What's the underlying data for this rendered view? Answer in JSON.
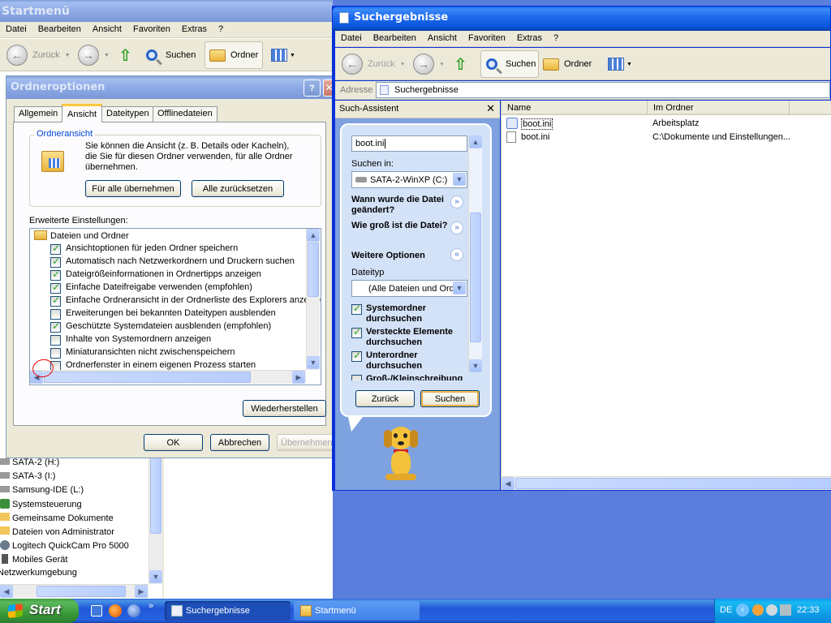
{
  "background_window": {
    "title": "Startmenü",
    "menu": [
      "Datei",
      "Bearbeiten",
      "Ansicht",
      "Favoriten",
      "Extras",
      "?"
    ],
    "toolbar": {
      "back": "Zurück",
      "search": "Suchen",
      "folders": "Ordner"
    },
    "tree_items": [
      "SATA-2 (H:)",
      "SATA-3 (I:)",
      "Samsung-IDE (L:)",
      "Systemsteuerung",
      "Gemeinsame Dokumente",
      "Dateien von Administrator",
      "Logitech QuickCam Pro 5000",
      "Mobiles Gerät",
      "Netzwerkumgebung"
    ]
  },
  "dialog": {
    "title": "Ordneroptionen",
    "tabs": [
      "Allgemein",
      "Ansicht",
      "Dateitypen",
      "Offlinedateien"
    ],
    "group_title": "Ordneransicht",
    "description": "Sie können die Ansicht (z. B. Details oder Kacheln), die Sie für diesen Ordner verwenden, für alle Ordner übernehmen.",
    "apply_all": "Für alle übernehmen",
    "reset_all": "Alle zurücksetzen",
    "advanced_label": "Erweiterte Einstellungen:",
    "folder_node": "Dateien und Ordner",
    "settings": [
      {
        "label": "Ansichtoptionen für jeden Ordner speichern",
        "checked": true
      },
      {
        "label": "Automatisch nach Netzwerkordnern und Druckern suchen",
        "checked": true
      },
      {
        "label": "Dateigrößeinformationen in Ordnertipps anzeigen",
        "checked": true
      },
      {
        "label": "Einfache Dateifreigabe verwenden (empfohlen)",
        "checked": true
      },
      {
        "label": "Einfache Ordneransicht in der Ordnerliste des Explorers anzeige",
        "checked": true
      },
      {
        "label": "Erweiterungen bei bekannten Dateitypen ausblenden",
        "checked": false
      },
      {
        "label": "Geschützte Systemdateien ausblenden (empfohlen)",
        "checked": true
      },
      {
        "label": "Inhalte von Systemordnern anzeigen",
        "checked": false
      },
      {
        "label": "Miniaturansichten nicht zwischenspeichern",
        "checked": false
      },
      {
        "label": "Ordnerfenster in einem eigenen Prozess starten",
        "checked": false
      }
    ],
    "restore": "Wiederherstellen",
    "ok": "OK",
    "cancel": "Abbrechen",
    "apply": "Übernehmen",
    "help": "?"
  },
  "search_window": {
    "title": "Suchergebnisse",
    "menu": [
      "Datei",
      "Bearbeiten",
      "Ansicht",
      "Favoriten",
      "Extras",
      "?"
    ],
    "toolbar": {
      "back": "Zurück",
      "search": "Suchen",
      "folders": "Ordner"
    },
    "address_label": "Adresse",
    "address_value": "Suchergebnisse",
    "assistant_title": "Such-Assistent",
    "search_value": "boot.ini",
    "search_in_label": "Suchen in:",
    "search_in_value": "SATA-2-WinXP (C:)",
    "when_modified": "Wann wurde die Datei geändert?",
    "how_big": "Wie groß ist die Datei?",
    "more_options": "Weitere Optionen",
    "filetype_label": "Dateityp",
    "filetype_value": "(Alle Dateien und Ord",
    "options": [
      {
        "label": "Systemordner durchsuchen",
        "checked": true
      },
      {
        "label": "Versteckte Elemente durchsuchen",
        "checked": true
      },
      {
        "label": "Unterordner durchsuchen",
        "checked": true
      },
      {
        "label": "Groß-/Kleinschreibung",
        "checked": false
      }
    ],
    "back_btn": "Zurück",
    "search_btn": "Suchen",
    "columns": [
      "Name",
      "Im Ordner"
    ],
    "results": [
      {
        "name": "boot.ini",
        "folder": "Arbeitsplatz"
      },
      {
        "name": "boot.ini",
        "folder": "C:\\Dokumente und Einstellungen..."
      }
    ]
  },
  "taskbar": {
    "start": "Start",
    "tasks": [
      "Suchergebnisse",
      "Startmenü"
    ],
    "language": "DE",
    "clock": "22:33"
  }
}
